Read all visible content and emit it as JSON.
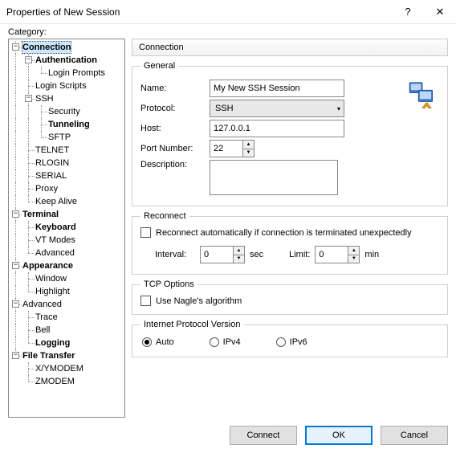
{
  "window": {
    "title": "Properties of New Session",
    "help_glyph": "?",
    "close_glyph": "✕"
  },
  "category_label": "Category:",
  "tree": [
    {
      "label": "Connection",
      "depth": 0,
      "exp": "-",
      "bold": true,
      "sel": true
    },
    {
      "label": "Authentication",
      "depth": 1,
      "exp": "-",
      "bold": true
    },
    {
      "label": "Login Prompts",
      "depth": 2
    },
    {
      "label": "Login Scripts",
      "depth": 1
    },
    {
      "label": "SSH",
      "depth": 1,
      "exp": "-"
    },
    {
      "label": "Security",
      "depth": 2
    },
    {
      "label": "Tunneling",
      "depth": 2,
      "bold": true
    },
    {
      "label": "SFTP",
      "depth": 2
    },
    {
      "label": "TELNET",
      "depth": 1
    },
    {
      "label": "RLOGIN",
      "depth": 1
    },
    {
      "label": "SERIAL",
      "depth": 1
    },
    {
      "label": "Proxy",
      "depth": 1
    },
    {
      "label": "Keep Alive",
      "depth": 1
    },
    {
      "label": "Terminal",
      "depth": 0,
      "exp": "-",
      "bold": true
    },
    {
      "label": "Keyboard",
      "depth": 1,
      "bold": true
    },
    {
      "label": "VT Modes",
      "depth": 1
    },
    {
      "label": "Advanced",
      "depth": 1
    },
    {
      "label": "Appearance",
      "depth": 0,
      "exp": "-",
      "bold": true
    },
    {
      "label": "Window",
      "depth": 1
    },
    {
      "label": "Highlight",
      "depth": 1
    },
    {
      "label": "Advanced",
      "depth": 0,
      "exp": "-"
    },
    {
      "label": "Trace",
      "depth": 1
    },
    {
      "label": "Bell",
      "depth": 1
    },
    {
      "label": "Logging",
      "depth": 1,
      "bold": true
    },
    {
      "label": "File Transfer",
      "depth": 0,
      "exp": "-",
      "bold": true
    },
    {
      "label": "X/YMODEM",
      "depth": 1
    },
    {
      "label": "ZMODEM",
      "depth": 1
    }
  ],
  "panel": {
    "header": "Connection",
    "general": {
      "legend": "General",
      "name_label": "Name:",
      "name_value": "My New SSH Session",
      "protocol_label": "Protocol:",
      "protocol_value": "SSH",
      "host_label": "Host:",
      "host_value": "127.0.0.1",
      "port_label": "Port Number:",
      "port_value": "22",
      "desc_label": "Description:",
      "desc_value": ""
    },
    "reconnect": {
      "legend": "Reconnect",
      "check_label": "Reconnect automatically if connection is terminated unexpectedly",
      "interval_label": "Interval:",
      "interval_value": "0",
      "interval_unit": "sec",
      "limit_label": "Limit:",
      "limit_value": "0",
      "limit_unit": "min"
    },
    "tcp": {
      "legend": "TCP Options",
      "nagle_label": "Use Nagle's algorithm"
    },
    "ipv": {
      "legend": "Internet Protocol Version",
      "auto": "Auto",
      "ipv4": "IPv4",
      "ipv6": "IPv6"
    }
  },
  "buttons": {
    "connect": "Connect",
    "ok": "OK",
    "cancel": "Cancel"
  }
}
